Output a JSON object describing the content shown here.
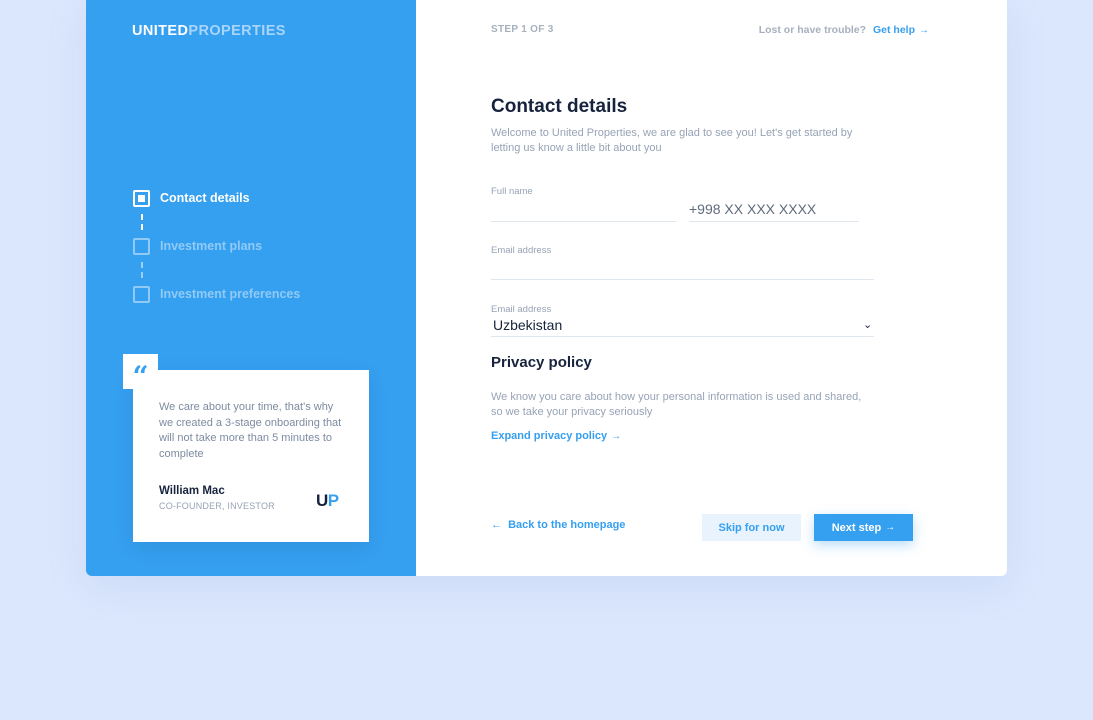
{
  "brand": {
    "part1": "UNITED",
    "part2": "PROPERTIES",
    "accent": "#359ff0"
  },
  "steps": [
    {
      "label": "Contact details",
      "active": true
    },
    {
      "label": "Investment plans",
      "active": false
    },
    {
      "label": "Investment preferences",
      "active": false
    }
  ],
  "testimonial": {
    "quote_mark": "“",
    "text": "We care about your time, that's why we created a 3-stage onboarding that will not take more than 5 minutes to complete",
    "author": "William Mac",
    "role": "CO-FOUNDER, INVESTOR",
    "logo_u": "U",
    "logo_p": "P"
  },
  "header": {
    "step_indicator": "STEP 1 OF 3",
    "help_muted": "Lost or have trouble?",
    "help_link": "Get help",
    "arrow_right": "→"
  },
  "form": {
    "title": "Contact details",
    "intro": "Welcome to United Properties, we are glad to see you! Let's get started by letting us know a little bit about you",
    "full_name_label": "Full name",
    "full_name_value": "",
    "phone_placeholder": "+998 XX XXX XXXX",
    "email_label": "Email address",
    "email_value": "",
    "country_label": "Email address",
    "country_value": "Uzbekistan",
    "chevron": "⌄"
  },
  "privacy": {
    "title": "Privacy policy",
    "text": "We know you care about how your personal information is used and shared, so we take your privacy seriously",
    "expand_link": "Expand privacy policy"
  },
  "footer": {
    "back_arrow": "←",
    "back_label": "Back to the homepage",
    "skip_label": "Skip for now",
    "next_label": "Next step"
  }
}
